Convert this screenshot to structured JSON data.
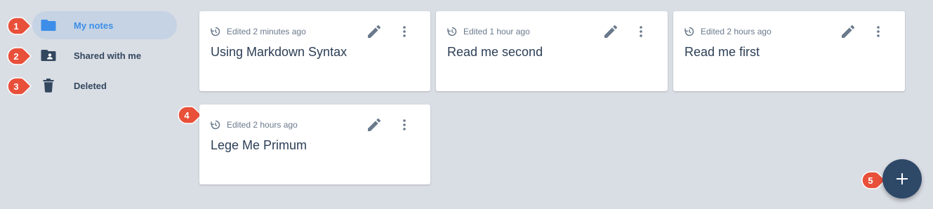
{
  "sidebar": {
    "items": [
      {
        "label": "My notes",
        "icon": "folder-icon",
        "active": true
      },
      {
        "label": "Shared with me",
        "icon": "shared-folder-icon",
        "active": false
      },
      {
        "label": "Deleted",
        "icon": "trash-icon",
        "active": false
      }
    ]
  },
  "notes": [
    {
      "edited": "Edited 2 minutes ago",
      "title": "Using Markdown Syntax"
    },
    {
      "edited": "Edited 1 hour ago",
      "title": "Read me second"
    },
    {
      "edited": "Edited 2 hours ago",
      "title": "Read me first"
    },
    {
      "edited": "Edited 2 hours ago",
      "title": "Lege Me Primum"
    }
  ],
  "callouts": [
    "1",
    "2",
    "3",
    "4",
    "5"
  ],
  "colors": {
    "background": "#d9dde4",
    "active_nav": "#c5d3e4",
    "accent": "#3d8ee8",
    "fab": "#2e4868",
    "callout": "#e8503a"
  }
}
